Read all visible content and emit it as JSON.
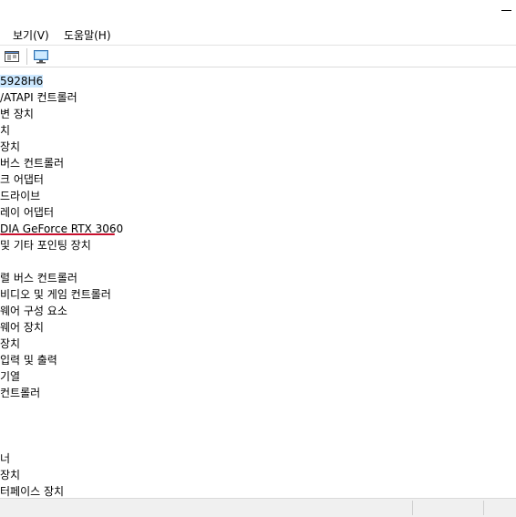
{
  "menu": {
    "view": "보기(V)",
    "help": "도움말(H)"
  },
  "toolbar": {
    "properties_icon": "properties-icon",
    "monitor_icon": "monitor-icon"
  },
  "tree": {
    "items": [
      "5928H6",
      "/ATAPI 컨트롤러",
      "변 장치",
      "치",
      "장치",
      "버스 컨트롤러",
      "크 어댑터",
      "드라이브",
      "레이 어댑터",
      "DIA GeForce RTX 3060",
      "및 기타 포인팅 장치",
      "",
      "렬 버스 컨트롤러",
      "비디오 및 게임 컨트롤러",
      "웨어 구성 요소",
      "웨어 장치",
      "장치",
      "입력 및 출력",
      "기열",
      "컨트롤러",
      "",
      "",
      "",
      "너",
      "장치",
      "터페이스 장치"
    ]
  },
  "colors": {
    "selection": "#cce8ff",
    "annotation_underline": "#c8102e"
  }
}
